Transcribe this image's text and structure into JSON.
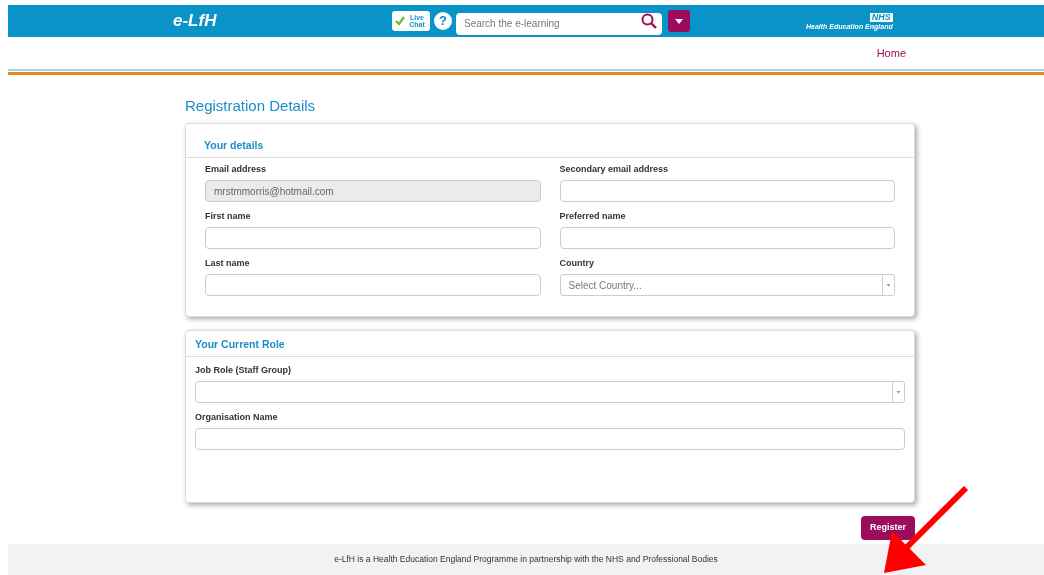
{
  "header": {
    "logo": "e-LfH",
    "live_chat": "Live Chat",
    "help": "?",
    "search": {
      "placeholder": "Search the e-learning"
    },
    "nhs_badge": "NHS",
    "nhs_org": "Health Education England"
  },
  "nav": {
    "links": [
      "Home"
    ]
  },
  "page_title": "Registration Details",
  "sections": [
    {
      "title": "Your details",
      "kind": "two-column",
      "fields": [
        {
          "kind": "text",
          "label": "Email address",
          "value": "mrstmmorris@hotmail.com",
          "disabled": true
        },
        {
          "kind": "text",
          "label": "Secondary email address",
          "disabled": false
        },
        {
          "kind": "text",
          "label": "First name",
          "disabled": false
        },
        {
          "kind": "text",
          "label": "Preferred name",
          "disabled": false
        },
        {
          "kind": "text",
          "label": "Last name",
          "disabled": false
        },
        {
          "kind": "select",
          "label": "Country",
          "placeholder": "Select Country...",
          "disabled": false
        }
      ]
    },
    {
      "title": "Your Current Role",
      "kind": "single-column",
      "fields": [
        {
          "kind": "select",
          "label": "Job Role (Staff Group)",
          "disabled": false
        },
        {
          "kind": "text",
          "label": "Organisation Name",
          "disabled": false
        }
      ]
    }
  ],
  "register_button": "Register",
  "footer": "e-LfH is a Health Education England Programme in partnership with the NHS and Professional Bodies"
}
